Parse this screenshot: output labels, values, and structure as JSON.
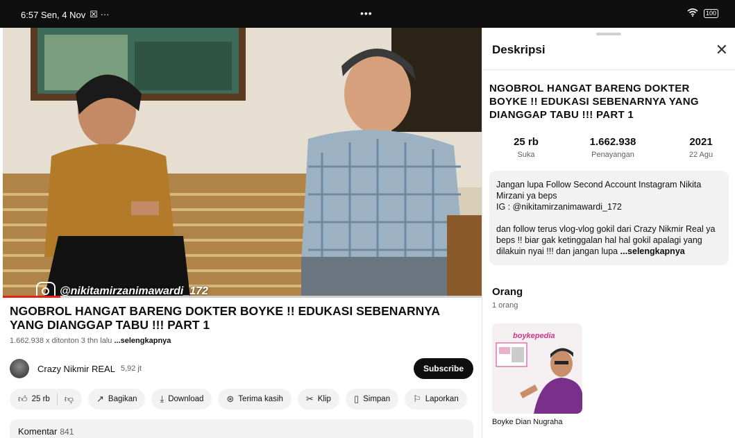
{
  "status_bar": {
    "time_date": "6:57 Sen, 4 Nov",
    "left_icons": "☒ ···",
    "center": "•••",
    "battery": "100"
  },
  "video": {
    "watermark": "@nikitamirzanimawardi_172",
    "progress_fraction": 0.12,
    "title": "NGOBROL HANGAT BARENG DOKTER BOYKE !! EDUKASI SEBENARNYA YANG DIANGGAP TABU !!! PART 1",
    "meta": "1.662.938 x ditonton  3 thn lalu",
    "meta_more": "...selengkapnya"
  },
  "channel": {
    "name": "Crazy Nikmir REAL",
    "subscribers": "5,92 jt",
    "subscribe_label": "Subscribe"
  },
  "actions": {
    "like_count": "25 rb",
    "share": "Bagikan",
    "download": "Download",
    "thanks": "Terima kasih",
    "clip": "Klip",
    "save": "Simpan",
    "report": "Laporkan"
  },
  "comments": {
    "label": "Komentar",
    "count": "841"
  },
  "panel": {
    "title": "Deskripsi",
    "video_title": "NGOBROL HANGAT BARENG DOKTER BOYKE !! EDUKASI SEBENARNYA YANG DIANGGAP TABU !!! PART 1",
    "stats": [
      {
        "value": "25 rb",
        "label": "Suka"
      },
      {
        "value": "1.662.938",
        "label": "Penayangan"
      },
      {
        "value": "2021",
        "label": "22 Agu"
      }
    ],
    "description": {
      "para1_line1": "Jangan lupa Follow Second Account Instagram Nikita Mirzani ya beps",
      "para1_line2": "IG : @nikitamirzanimawardi_172",
      "para2": "dan follow terus vlog-vlog gokil dari Crazy Nikmir Real ya beps !! biar gak ketinggalan hal hal gokil apalagi yang dilakuin nyai !!! dan jangan lupa",
      "more": "...selengkapnya"
    },
    "people": {
      "title": "Orang",
      "count": "1 orang",
      "person_image_label": "boykepedia",
      "person_name": "Boyke Dian Nugraha"
    }
  },
  "colors": {
    "accent_red": "#e62117",
    "text_primary": "#0f0f0f",
    "text_secondary": "#606060",
    "chip_bg": "#f2f2f2"
  }
}
